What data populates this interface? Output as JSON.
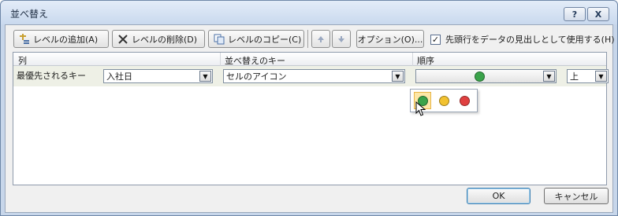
{
  "window": {
    "title": "並べ替え",
    "help_label": "?",
    "close_label": "X"
  },
  "toolbar": {
    "add_level": "レベルの追加(A)",
    "delete_level": "レベルの削除(D)",
    "copy_level": "レベルのコピー(C)",
    "move_up_icon": "arrow-up-icon",
    "move_down_icon": "arrow-down-icon",
    "options": "オプション(O)...",
    "header_checkbox_label": "先頭行をデータの見出しとして使用する(H)",
    "header_checkbox_checked": true
  },
  "grid": {
    "headers": {
      "column": "列",
      "sort_on": "並べ替えのキー",
      "order": "順序"
    },
    "rows": [
      {
        "label": "最優先されるキー",
        "column_value": "入社日",
        "sort_on_value": "セルのアイコン",
        "order_icon": "green-circle-icon",
        "order_direction": "上"
      }
    ]
  },
  "icon_popup": {
    "options": [
      {
        "name": "green-circle-icon",
        "color": "#3aa34a",
        "selected": true
      },
      {
        "name": "yellow-circle-icon",
        "color": "#f2c230",
        "selected": false
      },
      {
        "name": "red-circle-icon",
        "color": "#e04040",
        "selected": false
      }
    ]
  },
  "footer": {
    "ok": "OK",
    "cancel": "キャンセル"
  }
}
